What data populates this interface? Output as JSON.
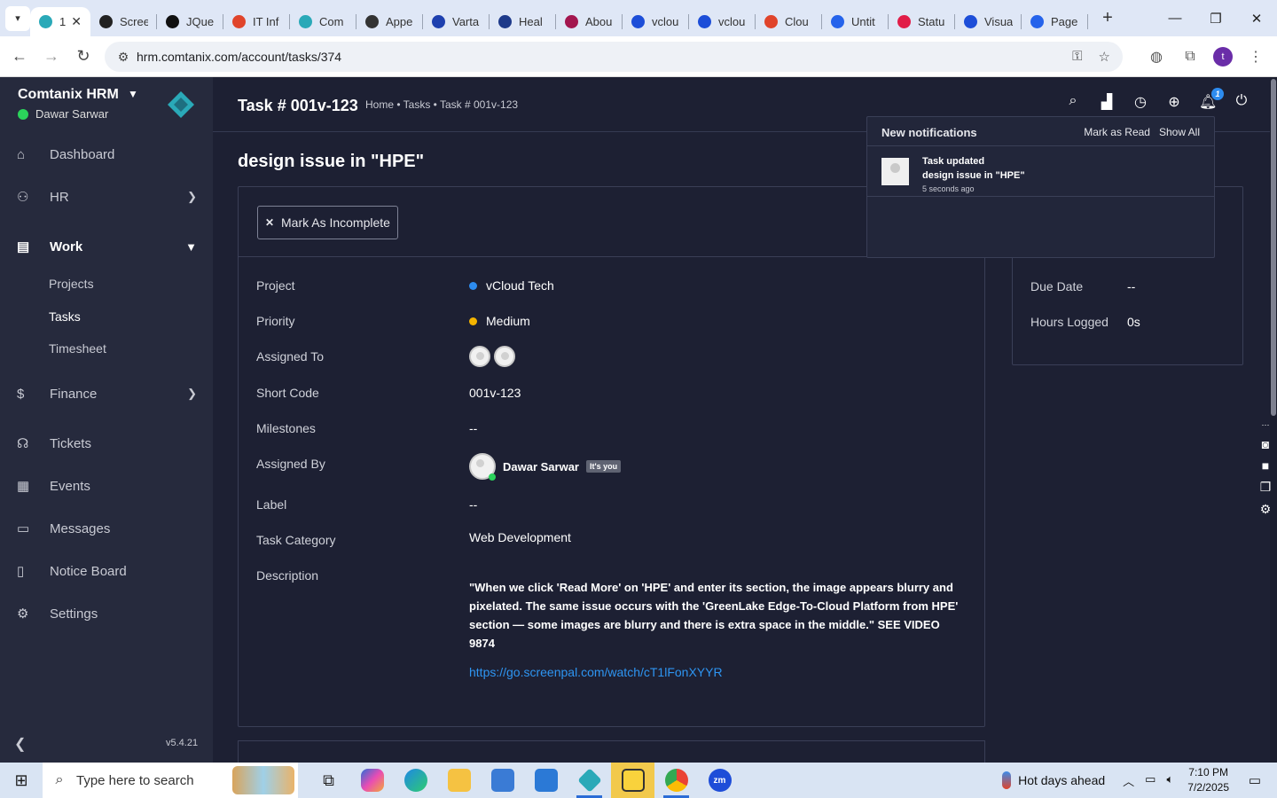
{
  "browser": {
    "tabs": [
      {
        "title": "1",
        "color": "#2aa9b8"
      },
      {
        "title": "Scree",
        "color": "#222222"
      },
      {
        "title": "JQue",
        "color": "#111111"
      },
      {
        "title": "IT Inf",
        "color": "#e0442b"
      },
      {
        "title": "Com",
        "color": "#2aa9b8"
      },
      {
        "title": "Appe",
        "color": "#333333"
      },
      {
        "title": "Varta",
        "color": "#1e40af"
      },
      {
        "title": "Heal",
        "color": "#1e3a8a"
      },
      {
        "title": "Abou",
        "color": "#a3164f"
      },
      {
        "title": "vclou",
        "color": "#1d4ed8"
      },
      {
        "title": "vclou",
        "color": "#1d4ed8"
      },
      {
        "title": "Clou",
        "color": "#e0442b"
      },
      {
        "title": "Untit",
        "color": "#2563eb"
      },
      {
        "title": "Statu",
        "color": "#e11d48"
      },
      {
        "title": "Visua",
        "color": "#1d4ed8"
      },
      {
        "title": "Page",
        "color": "#2563eb"
      }
    ],
    "url": "hrm.comtanix.com/account/tasks/374",
    "profile_initial": "t"
  },
  "sidebar": {
    "brand": "Comtanix HRM",
    "user": "Dawar Sarwar",
    "items": {
      "dashboard": "Dashboard",
      "hr": "HR",
      "work": "Work",
      "projects": "Projects",
      "tasks": "Tasks",
      "timesheet": "Timesheet",
      "finance": "Finance",
      "tickets": "Tickets",
      "events": "Events",
      "messages": "Messages",
      "notice_board": "Notice Board",
      "settings": "Settings"
    },
    "version": "v5.4.21"
  },
  "header": {
    "title": "Task # 001v-123",
    "breadcrumb": "Home • Tasks • Task # 001v-123",
    "notification_count": "1"
  },
  "task": {
    "heading": "design issue in \"HPE\"",
    "mark_incomplete_label": "Mark As Incomplete",
    "labels": {
      "project": "Project",
      "priority": "Priority",
      "assigned_to": "Assigned To",
      "short_code": "Short Code",
      "milestones": "Milestones",
      "assigned_by": "Assigned By",
      "label": "Label",
      "task_category": "Task Category",
      "description": "Description"
    },
    "values": {
      "project": "vCloud Tech",
      "project_color": "#2d8cf0",
      "priority": "Medium",
      "priority_color": "#f4b400",
      "short_code": "001v-123",
      "milestones": "--",
      "assigned_by": "Dawar Sarwar",
      "its_you": "It's you",
      "label": "--",
      "task_category": "Web Development",
      "description": "\"When we click 'Read More' on 'HPE' and enter its section, the image appears blurry and pixelated. The same issue occurs with the 'GreenLake Edge-To-Cloud Platform from HPE' section — some images are blurry and there is extra space in the middle.\" SEE VIDEO 9874",
      "link": "https://go.screenpal.com/watch/cT1lFonXYYR"
    }
  },
  "side_panel": {
    "due_date_label": "Due Date",
    "due_date": "--",
    "hours_logged_label": "Hours Logged",
    "hours_logged": "0s"
  },
  "notifications": {
    "title": "New notifications",
    "mark_read": "Mark as Read",
    "show_all": "Show All",
    "item": {
      "heading": "Task updated",
      "detail": "design issue in \"HPE\"",
      "time": "5 seconds ago"
    }
  },
  "taskbar": {
    "search_placeholder": "Type here to search",
    "weather": "Hot days ahead",
    "time": "7:10 PM",
    "date": "7/2/2025"
  }
}
